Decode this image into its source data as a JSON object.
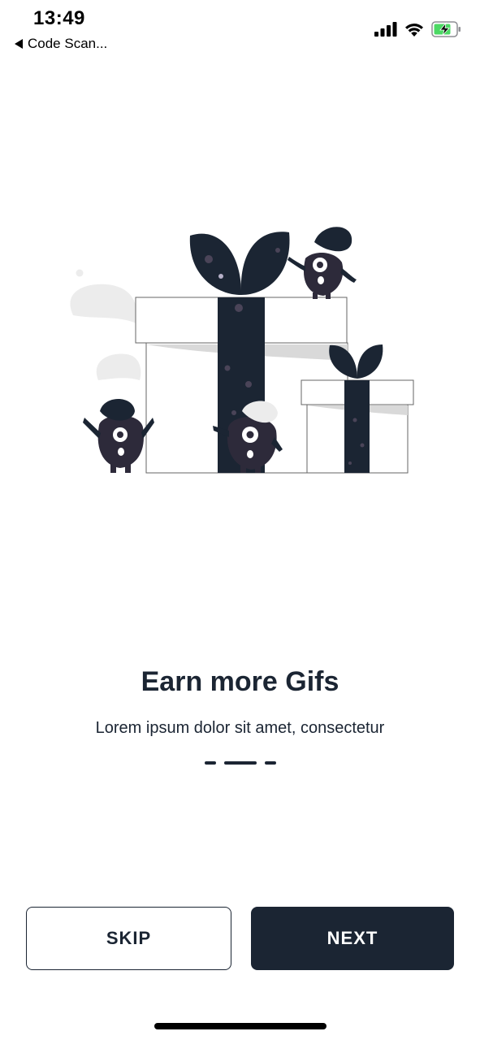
{
  "status_bar": {
    "time": "13:49",
    "back_app_label": "Code Scan...",
    "icons": [
      "signal-icon",
      "wifi-icon",
      "battery-charging-icon"
    ],
    "battery_color": "#4cd964"
  },
  "onboarding": {
    "title": "Earn more Gifs",
    "subtitle": "Lorem ipsum dolor sit amet, consectetur",
    "illustration_icon": "gift-boxes-monsters-illustration",
    "pages": 3,
    "current_page": 2
  },
  "buttons": {
    "skip_label": "SKIP",
    "next_label": "NEXT"
  },
  "colors": {
    "primary": "#1b2533",
    "background": "#ffffff"
  }
}
